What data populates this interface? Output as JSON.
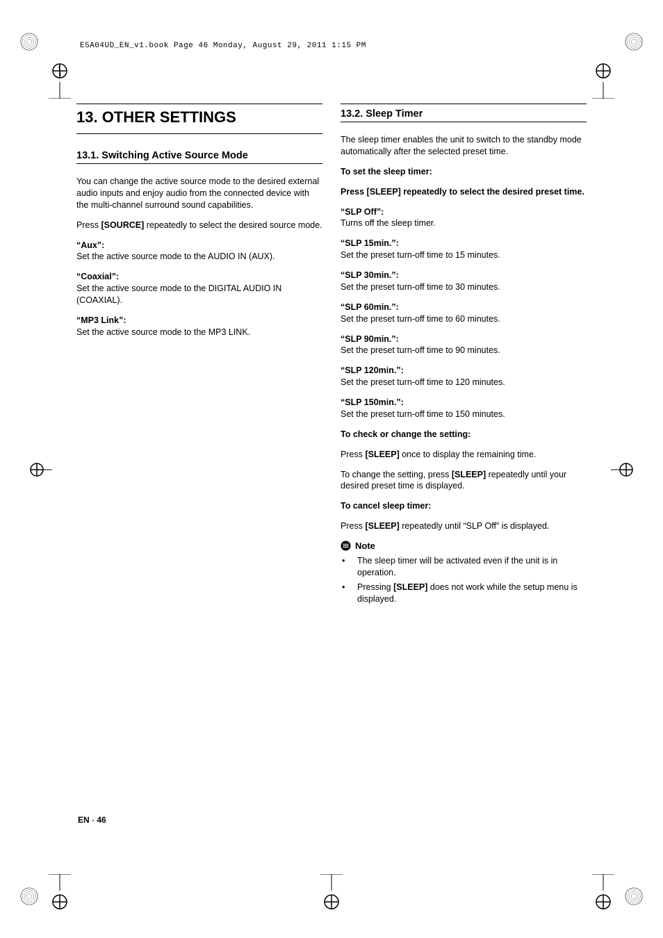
{
  "header": "E5A04UD_EN_v1.book  Page 46  Monday, August 29, 2011  1:15 PM",
  "chapter": "13.  OTHER SETTINGS",
  "left": {
    "section_title": "13.1. Switching Active Source Mode",
    "intro": "You can change the active source mode to the desired external audio inputs and enjoy audio from the connected device with the multi-channel surround sound capabilities.",
    "press_prefix": "Press ",
    "press_source": "[SOURCE]",
    "press_suffix": " repeatedly to select the desired source mode.",
    "aux_term": "“Aux”:",
    "aux_def": "Set the active source mode to the AUDIO IN (AUX).",
    "coax_term": "“Coaxial”:",
    "coax_def": "Set the active source mode to the DIGITAL AUDIO IN (COAXIAL).",
    "mp3_term": "“MP3 Link”:",
    "mp3_def": "Set the active source mode to the MP3 LINK."
  },
  "right": {
    "section_title": "13.2. Sleep Timer",
    "intro": "The sleep timer enables the unit to switch to the standby mode automatically after the selected preset time.",
    "to_set": "To set the sleep timer:",
    "press_prefix": "Press ",
    "press_sleep": "[SLEEP]",
    "press_suffix": " repeatedly to select the desired preset time.",
    "opts": [
      {
        "term": "“SLP Off”:",
        "def": "Turns off the sleep timer."
      },
      {
        "term": "“SLP 15min.”:",
        "def": "Set the preset turn-off time to 15 minutes."
      },
      {
        "term": "“SLP 30min.”:",
        "def": "Set the preset turn-off time to 30 minutes."
      },
      {
        "term": "“SLP 60min.”:",
        "def": "Set the preset turn-off time to 60 minutes."
      },
      {
        "term": "“SLP 90min.”:",
        "def": "Set the preset turn-off time to 90 minutes."
      },
      {
        "term": "“SLP 120min.”:",
        "def": "Set the preset turn-off time to 120 minutes."
      },
      {
        "term": "“SLP 150min.”:",
        "def": "Set the preset turn-off time to 150 minutes."
      }
    ],
    "check_heading": "To check or change the setting:",
    "check_press_prefix": "Press ",
    "check_press_sleep": "[SLEEP]",
    "check_press_suffix": " once to display the remaining time.",
    "change_prefix": "To change the setting, press ",
    "change_sleep": "[SLEEP]",
    "change_suffix": " repeatedly until your desired preset time is displayed.",
    "cancel_heading": "To cancel sleep timer:",
    "cancel_prefix": "Press ",
    "cancel_sleep": "[SLEEP]",
    "cancel_suffix": " repeatedly until “SLP Off” is displayed.",
    "note_label": "Note",
    "note_items": [
      {
        "text": "The sleep timer will be activated even if the unit is in operation."
      },
      {
        "prefix": "Pressing ",
        "bold": "[SLEEP]",
        "suffix": " does not work while the setup menu is displayed."
      }
    ]
  },
  "footer": {
    "lang": "EN",
    "sep": " - ",
    "page": "46"
  }
}
